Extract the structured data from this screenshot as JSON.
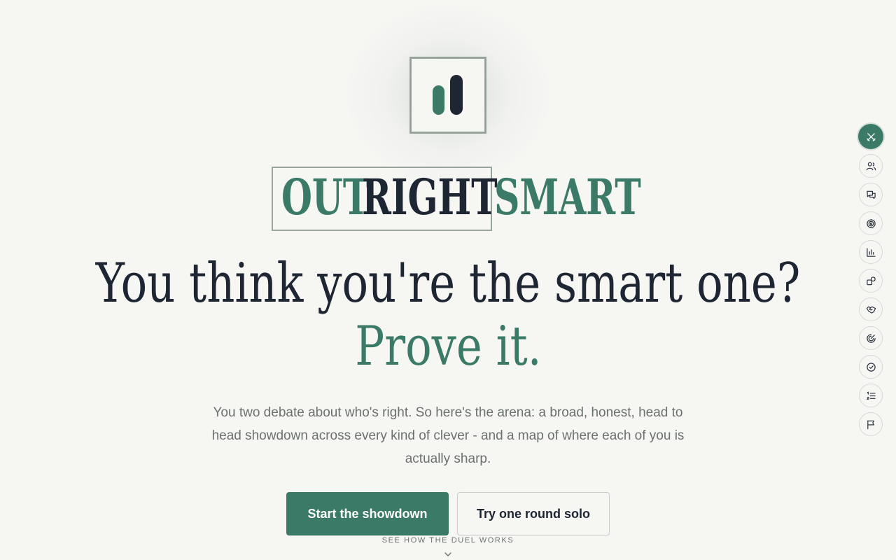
{
  "brand": {
    "part1": "OUT",
    "part2": "RIGHT",
    "part3": "SMART",
    "logo_icon": "bar-chart-logo-icon",
    "colors": {
      "accent": "#3b7a66",
      "ink": "#1e2533",
      "frame": "#98a39b",
      "background": "#f6f6f3"
    }
  },
  "hero": {
    "headline_line1": "You think you're the smart one?",
    "headline_line2": "Prove it.",
    "subtext": "You two debate about who's right. So here's the arena: a broad, honest, head to head showdown across every kind of clever - and a map of where each of you is actually sharp."
  },
  "actions": {
    "primary_label": "Start the showdown",
    "secondary_label": "Try one round solo",
    "how_it_works_label": "SEE HOW THE DUEL WORKS"
  },
  "side_nav": {
    "items": [
      {
        "icon": "crossed-swords-icon",
        "active": true
      },
      {
        "icon": "users-icon",
        "active": false
      },
      {
        "icon": "chat-bubbles-icon",
        "active": false
      },
      {
        "icon": "target-icon",
        "active": false
      },
      {
        "icon": "bar-chart-icon",
        "active": false
      },
      {
        "icon": "shapes-icon",
        "active": false
      },
      {
        "icon": "handshake-icon",
        "active": false
      },
      {
        "icon": "radar-icon",
        "active": false
      },
      {
        "icon": "check-circle-icon",
        "active": false
      },
      {
        "icon": "numbered-list-icon",
        "active": false
      },
      {
        "icon": "flag-icon",
        "active": false
      }
    ]
  }
}
